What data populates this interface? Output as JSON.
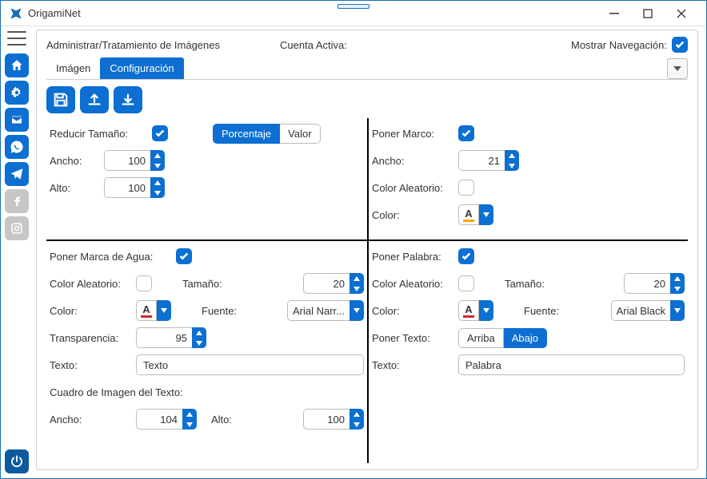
{
  "window_title": "OrigamiNet",
  "breadcrumb": "Administrar/Tratamiento de Imágenes",
  "account_label": "Cuenta Activa:",
  "nav_toggle_label": "Mostrar Navegación:",
  "tabs": {
    "image": "Imágen",
    "config": "Configuración"
  },
  "resize": {
    "title": "Reducir Tamaño:",
    "pct": "Porcentaje",
    "val": "Valor",
    "width_l": "Ancho:",
    "width_v": "100",
    "height_l": "Alto:",
    "height_v": "100"
  },
  "frame": {
    "title": "Poner Marco:",
    "width_l": "Ancho:",
    "width_v": "21",
    "rand_l": "Color Aleatorio:",
    "color_l": "Color:"
  },
  "wm": {
    "title": "Poner Marca de Agua:",
    "rand_l": "Color Aleatorio:",
    "size_l": "Tamaño:",
    "size_v": "20",
    "color_l": "Color:",
    "font_l": "Fuente:",
    "font_v": "Arial Narr...",
    "alpha_l": "Transparencia:",
    "alpha_v": "95",
    "text_l": "Texto:",
    "text_v": "Texto",
    "box_l": "Cuadro de Imagen del Texto:",
    "bw_l": "Ancho:",
    "bw_v": "104",
    "bh_l": "Alto:",
    "bh_v": "100"
  },
  "word": {
    "title": "Poner Palabra:",
    "rand_l": "Color Aleatorio:",
    "size_l": "Tamaño:",
    "size_v": "20",
    "color_l": "Color:",
    "font_l": "Fuente:",
    "font_v": "Arial Black",
    "pos_l": "Poner Texto:",
    "top": "Arriba",
    "bot": "Abajo",
    "text_l": "Texto:",
    "text_v": "Palabra"
  }
}
